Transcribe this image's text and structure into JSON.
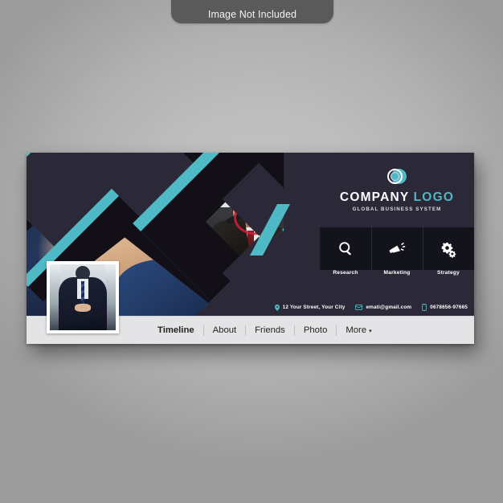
{
  "watermark": {
    "text": "Image Not Included"
  },
  "colors": {
    "teal": "#4fb9c6",
    "navy": "#2b2937",
    "panel_dark": "#13131b",
    "near_black": "#15141c",
    "navbar_bg": "#e4e4e6",
    "page_bg": "#b8b8b8"
  },
  "banner": {
    "logo": {
      "mark": "overlapping-circles-logo-icon",
      "word1": "COMPANY",
      "word2": "LOGO",
      "tagline": "GLOBAL BUSINESS SYSTEM"
    },
    "services": [
      {
        "icon": "magnifier-icon",
        "label": "Research"
      },
      {
        "icon": "megaphone-icon",
        "label": "Marketing"
      },
      {
        "icon": "gears-icon",
        "label": "Strategy"
      }
    ],
    "contact": [
      {
        "icon": "location-pin-icon",
        "text": "12 Your Street, Your City"
      },
      {
        "icon": "envelope-icon",
        "text": "emati@gmail.com"
      },
      {
        "icon": "phone-icon",
        "text": "0678656-97665"
      }
    ],
    "photos": {
      "left": "businessman-touching-digital-interface-photo",
      "center": "man-drawing-red-target-diagram-photo",
      "right_small": "woman-portrait-photo",
      "profile": "businessman-in-suit-profile-photo"
    }
  },
  "navbar": {
    "items": [
      {
        "label": "Timeline",
        "active": true
      },
      {
        "label": "About",
        "active": false
      },
      {
        "label": "Friends",
        "active": false
      },
      {
        "label": "Photo",
        "active": false
      },
      {
        "label": "More",
        "active": false,
        "caret": "▾"
      }
    ]
  }
}
